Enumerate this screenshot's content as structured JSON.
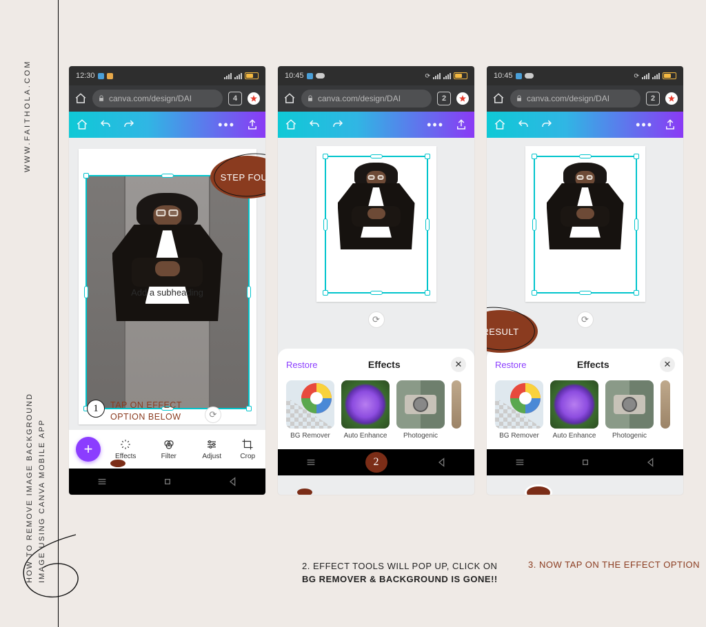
{
  "side": {
    "url": "WWW.FAITHOLA.COM",
    "title_line1": "HOW  TO  REMOVE    IMAGE  BACKGROUND",
    "title_line2": "IMAGE USING CANVA MOBILE  APP"
  },
  "badges": {
    "step_four": "STEP FOUR",
    "result": "RESULT"
  },
  "phone_common": {
    "url": "canva.com/design/DAI",
    "subheading": "Add a subheading"
  },
  "phone1": {
    "time": "12:30",
    "tabs": "4",
    "tools": {
      "effects": "Effects",
      "filter": "Filter",
      "adjust": "Adjust",
      "crop": "Crop"
    },
    "note_num": "1",
    "note_l1": "TAP ON EFFECT",
    "note_l2": "OPTION BELOW"
  },
  "phone2": {
    "time": "10:45",
    "tabs": "2"
  },
  "phone3": {
    "time": "10:45",
    "tabs": "2"
  },
  "effects": {
    "restore": "Restore",
    "title": "Effects",
    "items": {
      "bg": "BG Remover",
      "auto": "Auto Enhance",
      "photo": "Photogenic"
    }
  },
  "captions": {
    "c2a": "2. EFFECT TOOLS WILL POP UP, CLICK ON",
    "c2b": "BG REMOVER & BACKGROUND IS GONE!!",
    "c3": "3. NOW TAP ON THE EFFECT OPTION"
  },
  "nav_step2": "2"
}
